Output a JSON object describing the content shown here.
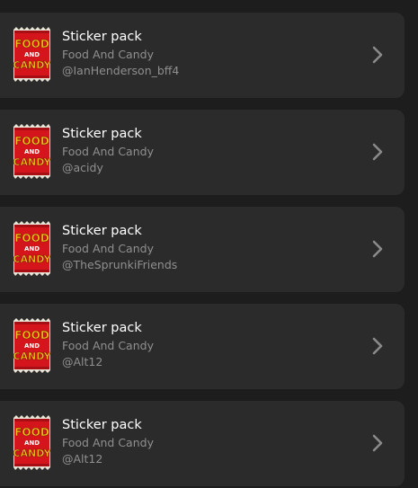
{
  "items": [
    {
      "title": "Sticker pack",
      "subtitle": "Food And Candy",
      "author": "@IanHenderson_bff4",
      "thumb_text": [
        "FOOD",
        "AND",
        "CANDY"
      ]
    },
    {
      "title": "Sticker pack",
      "subtitle": "Food And Candy",
      "author": "@acidy",
      "thumb_text": [
        "FOOD",
        "AND",
        "CANDY"
      ]
    },
    {
      "title": "Sticker pack",
      "subtitle": "Food And Candy",
      "author": "@TheSprunkiFriends",
      "thumb_text": [
        "FOOD",
        "AND",
        "CANDY"
      ]
    },
    {
      "title": "Sticker pack",
      "subtitle": "Food And Candy",
      "author": "@Alt12",
      "thumb_text": [
        "FOOD",
        "AND",
        "CANDY"
      ]
    },
    {
      "title": "Sticker pack",
      "subtitle": "Food And Candy",
      "author": "@Alt12",
      "thumb_text": [
        "FOOD",
        "AND",
        "CANDY"
      ]
    }
  ],
  "icons": {
    "thumbnail": "candy-wrapper-icon",
    "chevron": "chevron-right-icon"
  },
  "colors": {
    "background": "#1d1d1d",
    "card": "#2b2b2b",
    "title": "#ffffff",
    "secondary": "#8f8f8f",
    "wrapper_red": "#d4151b",
    "wrapper_yellow": "#f4c21a"
  }
}
